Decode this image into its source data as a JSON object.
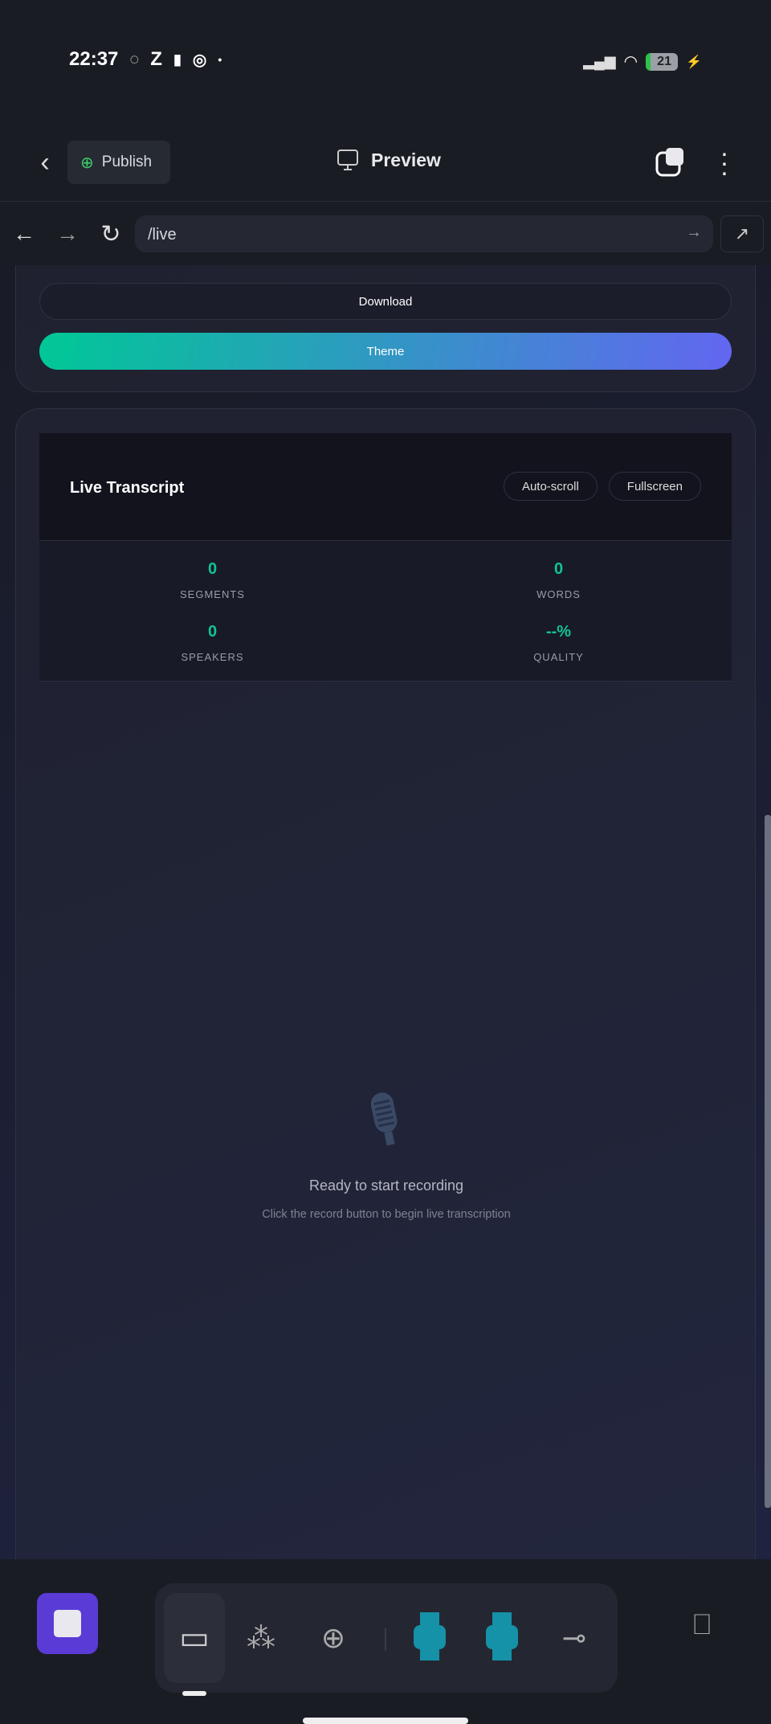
{
  "status": {
    "time": "22:37",
    "battery": "21"
  },
  "header": {
    "publish": "Publish",
    "title": "Preview"
  },
  "browser": {
    "url": "/live"
  },
  "controls": {
    "download": "Download",
    "theme": "Theme"
  },
  "transcript": {
    "title": "Live Transcript",
    "autoscroll": "Auto-scroll",
    "fullscreen": "Fullscreen",
    "stats": [
      {
        "value": "0",
        "label": "SEGMENTS"
      },
      {
        "value": "0",
        "label": "WORDS"
      },
      {
        "value": "0",
        "label": "SPEAKERS"
      },
      {
        "value": "--%",
        "label": "QUALITY"
      }
    ],
    "empty_title": "Ready to start recording",
    "empty_sub": "Click the record button to begin live transcription"
  },
  "colors": {
    "accent": "#10c48f",
    "gradient_start": "#00c896",
    "gradient_end": "#6366f1",
    "stop": "#5a3bd6"
  }
}
